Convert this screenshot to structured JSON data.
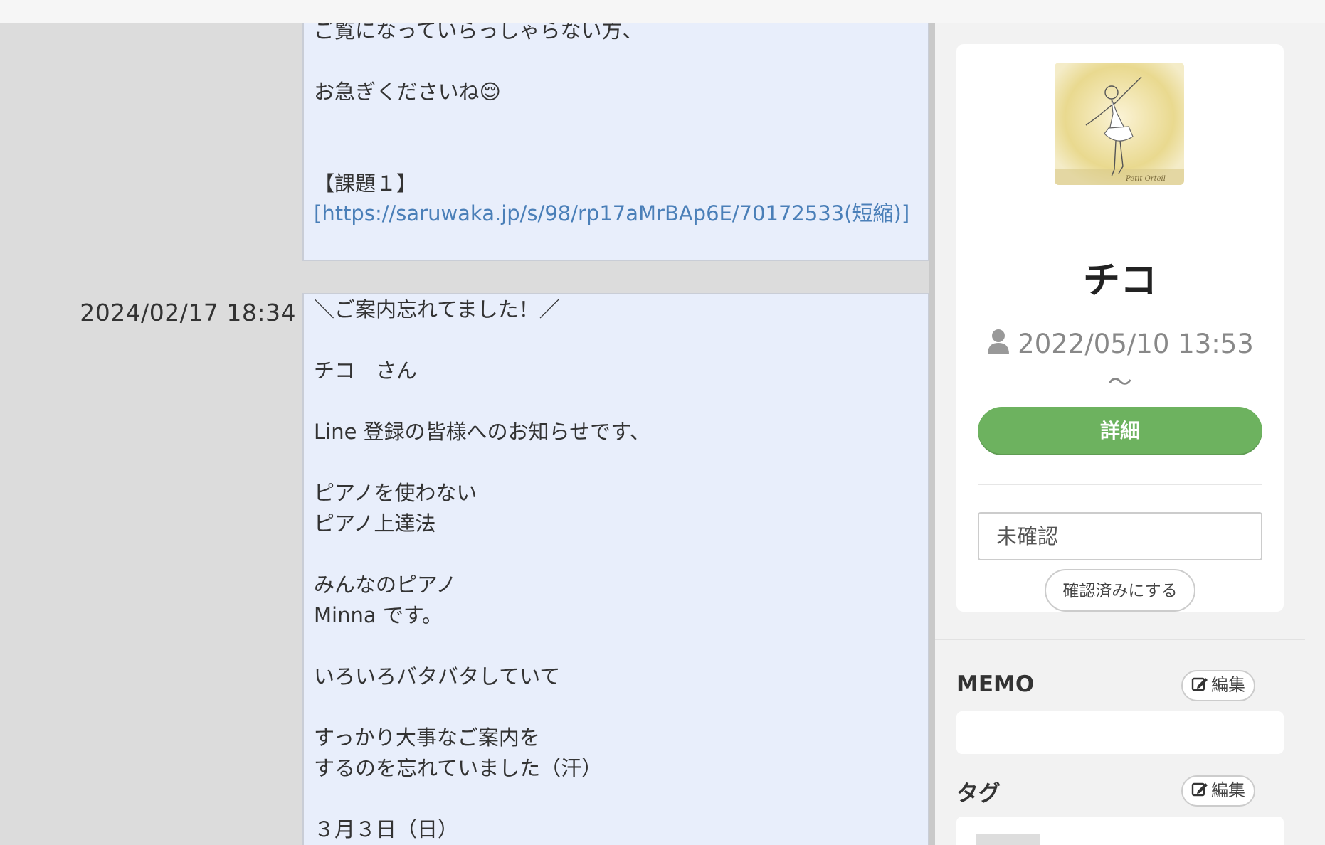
{
  "chat": {
    "message1": {
      "lines": "ご覧になっていらっしゃらない方、\n\nお急ぎくださいね😌\n\n\n【課題１】",
      "link": "[https://saruwaka.jp/s/98/rp17aMrBAp6E/70172533(短縮)]"
    },
    "message2": {
      "timestamp": "2024/02/17 18:34",
      "body": "＼ご案内忘れてました！／\n\nチコ　さん\n\nLine 登録の皆様へのお知らせです、\n\nピアノを使わない\nピアノ上達法\n\nみんなのピアノ\nMinna です。\n\nいろいろバタバタしていて\n\nすっかり大事なご案内を\nするのを忘れていました（汗）\n\n３月３日（日）"
    }
  },
  "profile": {
    "name": "チコ",
    "since": "2022/05/10 13:53",
    "tilde": "〜",
    "detail_button": "詳細",
    "status_value": "未確認",
    "confirm_button": "確認済みにする"
  },
  "memo": {
    "title": "MEMO",
    "edit_label": "編集"
  },
  "tags": {
    "title": "タグ",
    "edit_label": "編集"
  },
  "colors": {
    "bubble_bg": "#e8eefb",
    "link": "#4a7fb8",
    "detail_button": "#6db25f"
  }
}
